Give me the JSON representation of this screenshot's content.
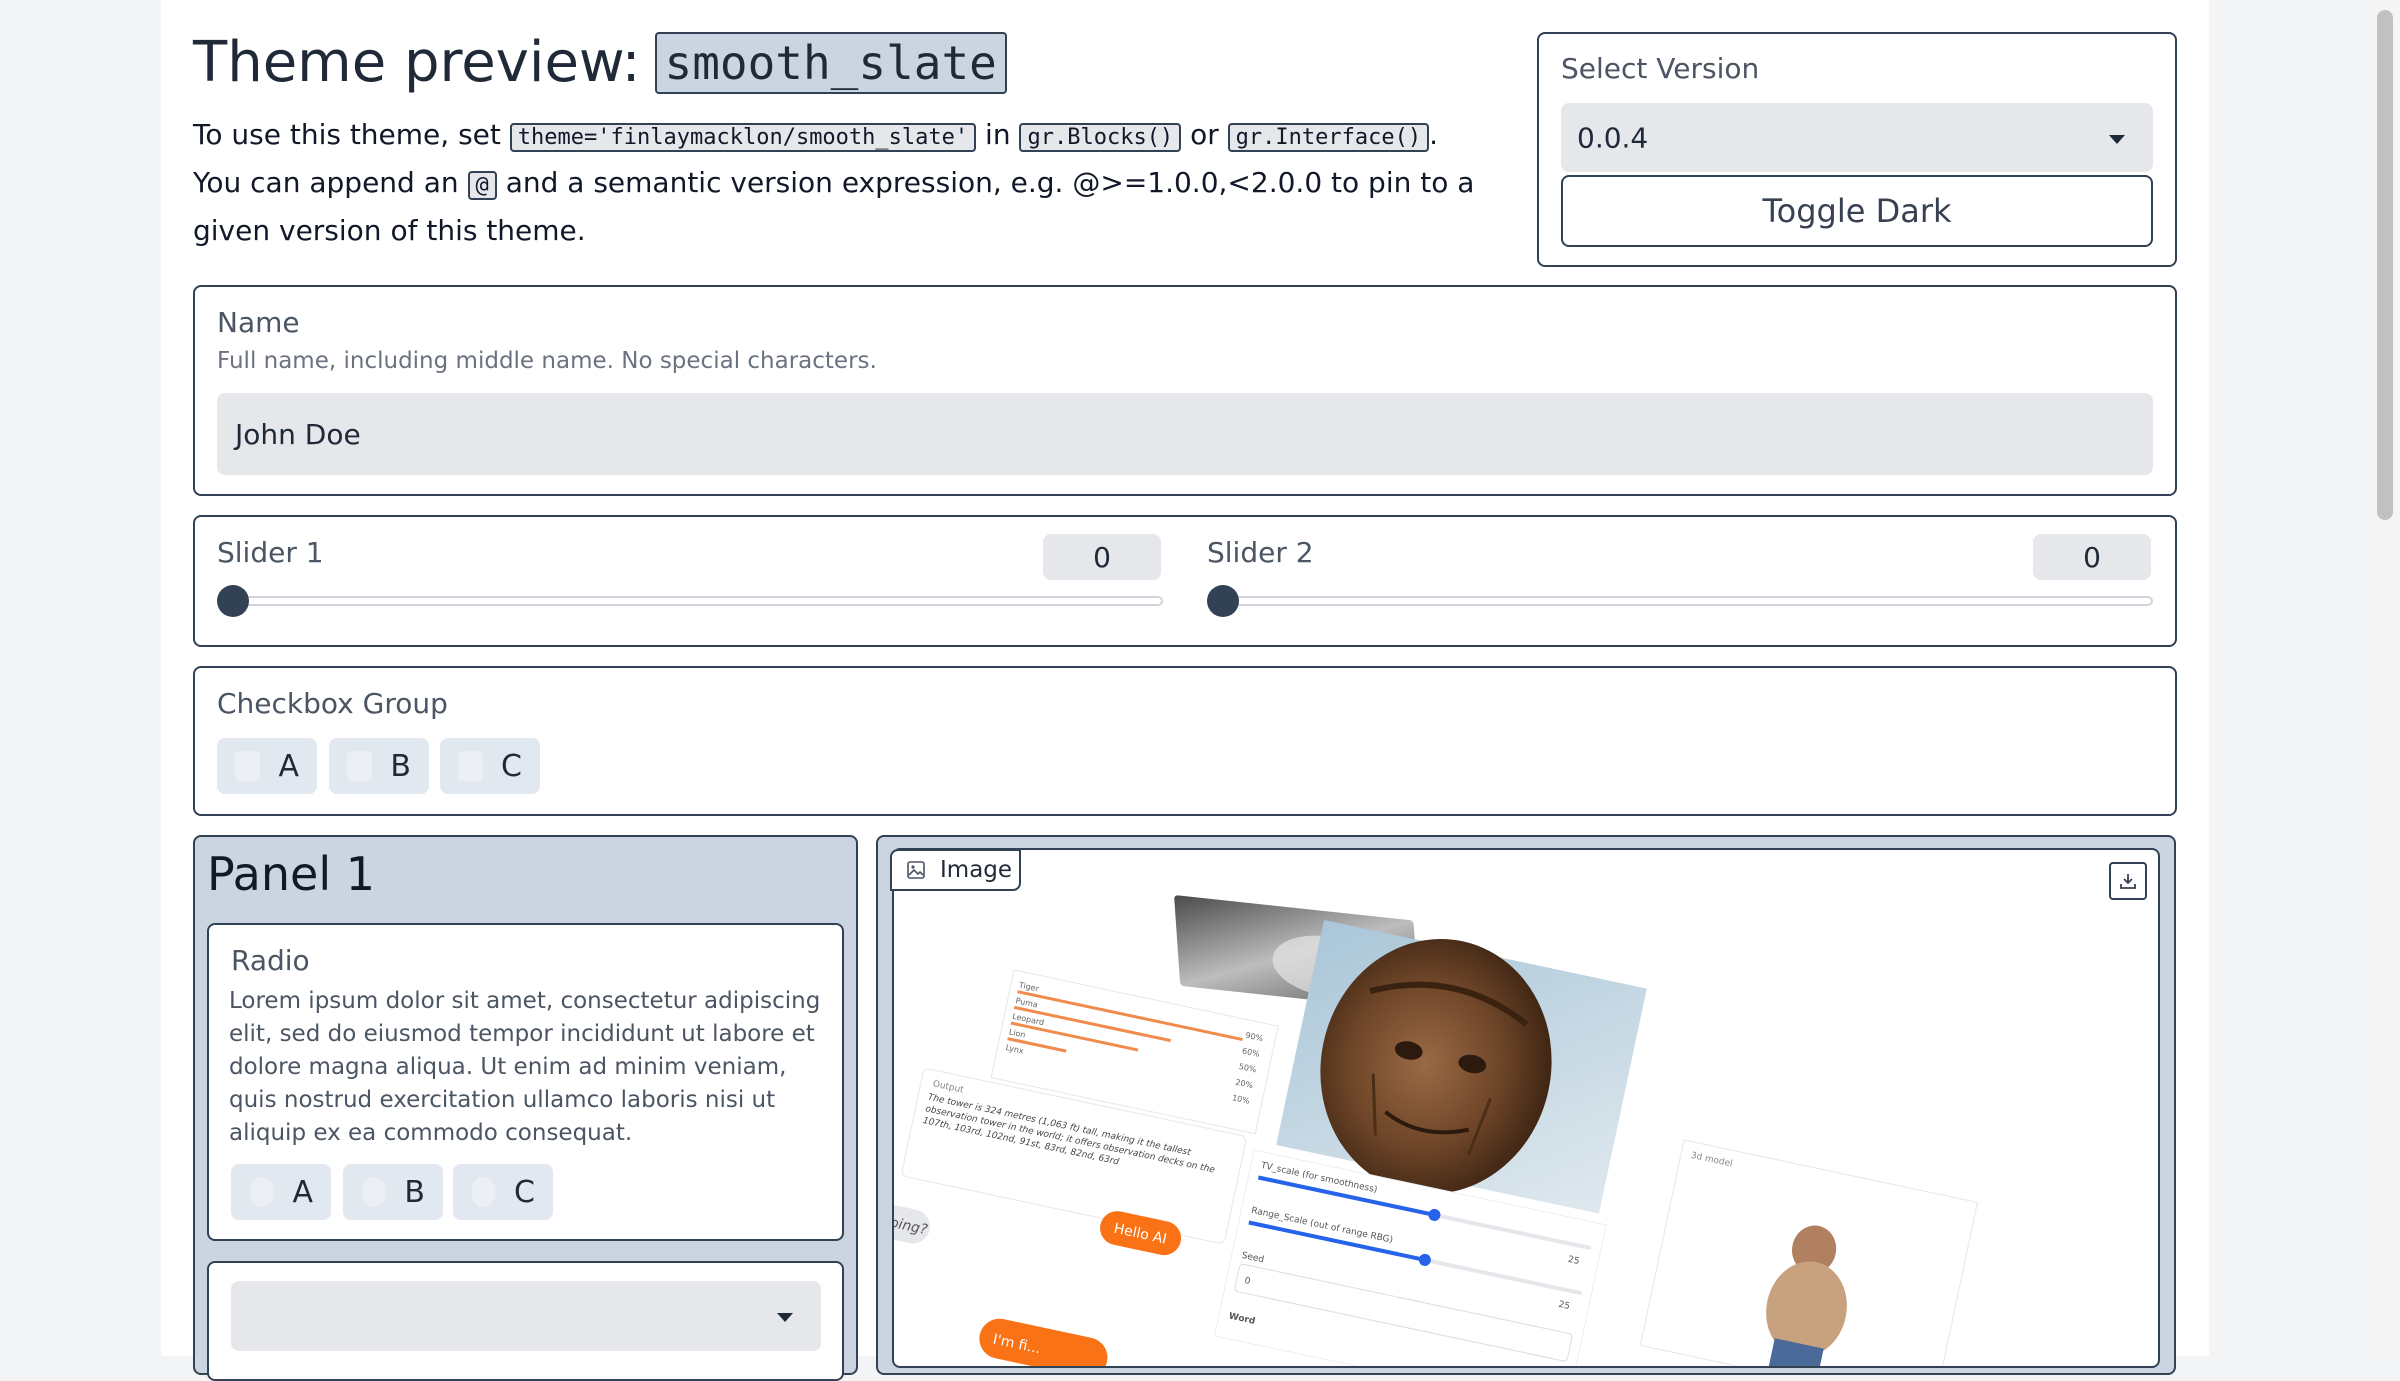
{
  "header": {
    "title_prefix": "Theme preview:",
    "title_code": "smooth_slate",
    "line1_a": "To use this theme, set",
    "code_theme": "theme='finlaymacklon/smooth_slate'",
    "line1_in": "in",
    "code_blocks": "gr.Blocks()",
    "line1_or": "or",
    "code_interface": "gr.Interface()",
    "line1_end": ".",
    "line2_a": "You can append an",
    "code_at": "@",
    "line2_b": "and a semantic version expression, e.g. @>=1.0.0,<2.0.0 to pin to a given version of this theme."
  },
  "version_box": {
    "label": "Select Version",
    "selected": "0.0.4",
    "toggle_label": "Toggle Dark"
  },
  "name_box": {
    "label": "Name",
    "info": "Full name, including middle name. No special characters.",
    "value": "John Doe"
  },
  "sliders": [
    {
      "label": "Slider 1",
      "value": "0",
      "fraction": 0
    },
    {
      "label": "Slider 2",
      "value": "0",
      "fraction": 0
    }
  ],
  "checkbox_group": {
    "label": "Checkbox Group",
    "options": [
      "A",
      "B",
      "C"
    ]
  },
  "panel1": {
    "title": "Panel 1",
    "radio_label": "Radio",
    "radio_info": "Lorem ipsum dolor sit amet, consectetur adipiscing elit, sed do eiusmod tempor incididunt ut labore et dolore magna aliqua. Ut enim ad minim veniam, quis nostrud exercitation ullamco laboris nisi ut aliquip ex ea commodo consequat.",
    "radio_options": [
      "A",
      "B",
      "C"
    ],
    "dropdown_value": ""
  },
  "image_panel": {
    "label": "Image",
    "preview": {
      "output_label": "Output",
      "output_text": "The tower is 324 metres (1,063 ft) tall, making it the tallest observation tower in the world; it offers observation decks on the 107th, 103rd, 102nd, 91st, 83rd, 82nd, 63rd",
      "bar_labels": [
        "Tiger",
        "Puma",
        "Leopard",
        "Lion",
        "Lynx"
      ],
      "bar_values": [
        "90%",
        "60%",
        "50%",
        "20%",
        "10%"
      ],
      "tv_label": "TV_scale (for smoothness)",
      "range_label": "Range_Scale (out of range RBG)",
      "seed_label": "Seed",
      "seed_value": "0",
      "slider_max": "25",
      "chat_right": "Hello AI",
      "chat_left": "oing?",
      "chat_bottom": "I'm fi...",
      "model_label": "3d model",
      "word_label": "Word"
    }
  },
  "icons": {
    "image_tag": "image-icon",
    "download": "download-icon",
    "dropdown": "chevron-down-icon"
  }
}
